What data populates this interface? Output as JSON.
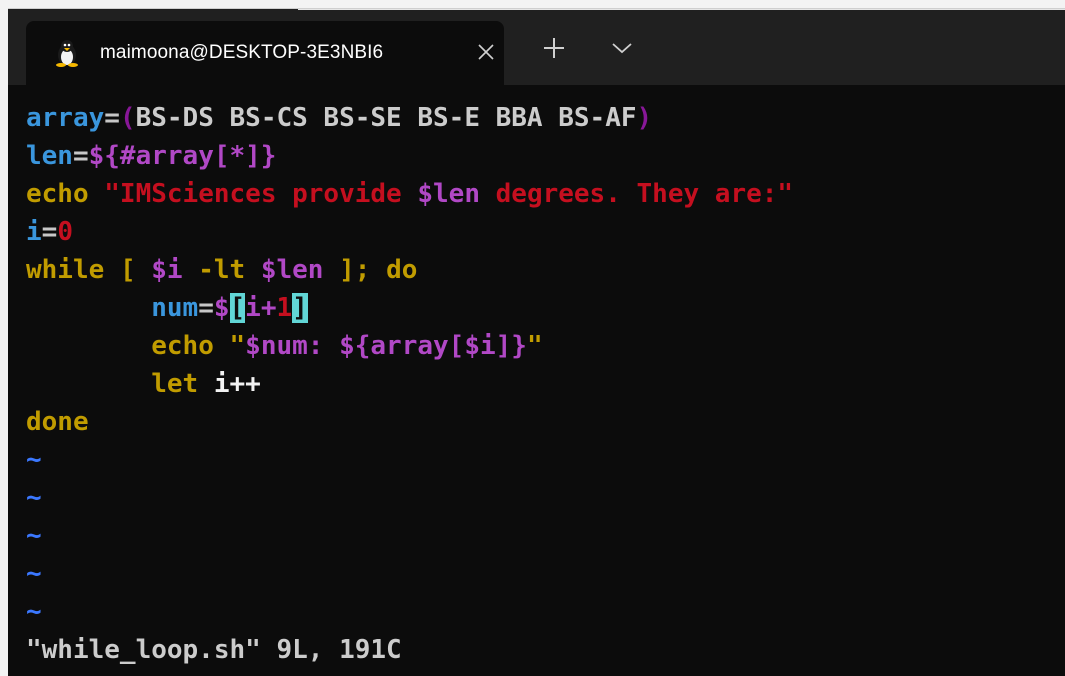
{
  "tab": {
    "title": "maimoona@DESKTOP-3E3NBI6",
    "icon": "linux-penguin-icon"
  },
  "titlebar": {
    "close_glyph": "✕",
    "new_tab_glyph": "+",
    "dropdown_glyph": "⌄"
  },
  "code": {
    "l1": {
      "var": "array",
      "eq": "=",
      "open": "(",
      "items": "BS-DS BS-CS BS-SE BS-E BBA BS-AF",
      "close": ")"
    },
    "l2": {
      "var": "len",
      "eq": "=",
      "expr": "${#array[*]}"
    },
    "l3": {
      "kw": "echo",
      "space": " ",
      "str1": "\"IMSciences provide ",
      "var": "$len",
      "str2": " degrees. They are:\""
    },
    "l4": {
      "var": "i",
      "eq": "=",
      "num": "0"
    },
    "l5": {
      "kw1": "while",
      "sp1": " ",
      "br1": "[",
      "sp2": " ",
      "v1": "$i",
      "op": " -lt ",
      "v2": "$len",
      "sp3": " ",
      "br2": "]",
      "semi": ";",
      "kw2": " do"
    },
    "l6": {
      "indent": "        ",
      "var": "num",
      "eq": "=",
      "dollar": "$",
      "lb": "[",
      "i": "i",
      "plus": "+",
      "one": "1",
      "rb": "]"
    },
    "l7": {
      "indent": "        ",
      "kw": "echo",
      "space": " ",
      "q1": "\"",
      "expr": "$num: ${array[$i]}",
      "q2": "\""
    },
    "l8": {
      "indent": "        ",
      "kw": "let",
      "rest": " i++"
    },
    "l9": {
      "kw": "done"
    }
  },
  "tildes": [
    "~",
    "~",
    "~",
    "~",
    "~"
  ],
  "status_line": "\"while_loop.sh\" 9L, 191C",
  "colors": {
    "background": "#0c0c0c",
    "titlebar": "#202020",
    "variable": "#3a96dd",
    "keyword": "#c19c00",
    "string": "#c50f1f",
    "purple": "#b148c6",
    "tilde": "#3b78ff",
    "bracket_highlight": "#61d6d6"
  }
}
